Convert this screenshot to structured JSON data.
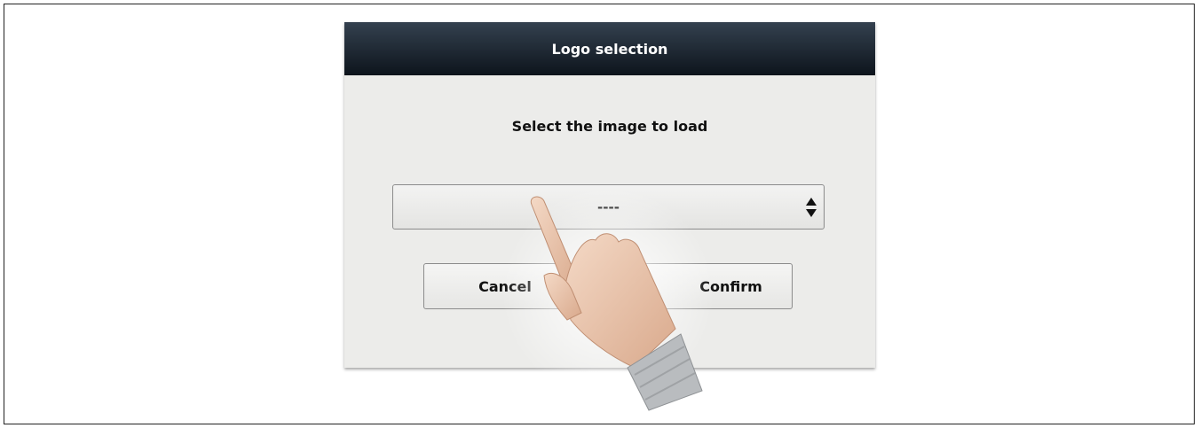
{
  "dialog": {
    "title": "Logo selection",
    "prompt": "Select the image to load",
    "select_value": "----",
    "cancel_label": "Cancel",
    "confirm_label": "Confirm"
  },
  "icons": {
    "select_arrows": "up-down-arrows-icon",
    "hand": "pointing-hand-icon"
  },
  "colors": {
    "titlebar": "#0d141c",
    "dialog_bg": "#ececea",
    "button_border": "#8b8b8b"
  }
}
